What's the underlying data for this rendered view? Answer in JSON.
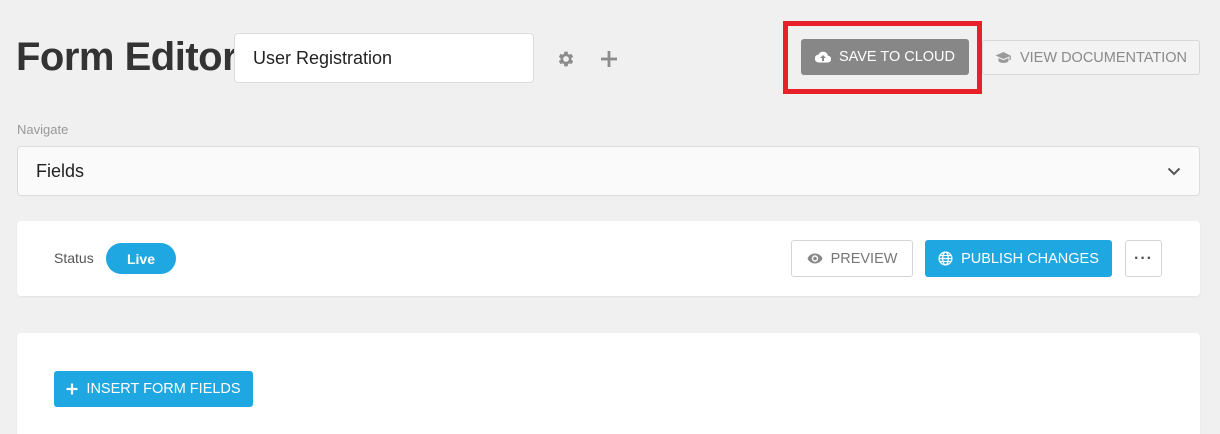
{
  "header": {
    "title": "Form Editor",
    "form_name_value": "User Registration",
    "settings_icon": "gear-icon",
    "add_icon": "plus-icon",
    "save_label": "SAVE TO CLOUD",
    "save_icon": "cloud-upload-icon",
    "docs_label": "VIEW DOCUMENTATION",
    "docs_icon": "graduation-cap-icon"
  },
  "navigate": {
    "label": "Navigate",
    "selected": "Fields",
    "icon": "chevron-down-icon"
  },
  "status_bar": {
    "label": "Status",
    "badge": "Live",
    "preview_label": "PREVIEW",
    "preview_icon": "eye-icon",
    "publish_label": "PUBLISH CHANGES",
    "publish_icon": "globe-icon",
    "more_label": "···"
  },
  "fields_panel": {
    "insert_label": "INSERT FORM FIELDS",
    "insert_icon": "plus-icon"
  },
  "colors": {
    "accent": "#1ea7e1",
    "save_button": "#878787",
    "highlight": "#e8202a",
    "background": "#f0f0f0"
  }
}
